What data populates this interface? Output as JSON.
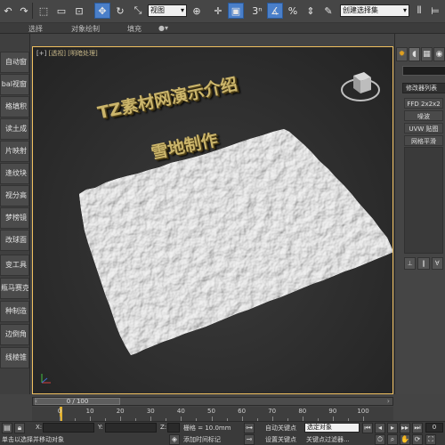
{
  "toolbar": {
    "selection_filter": "视图",
    "named_selection": "创建选择集",
    "snap_value": "3",
    "percent_snap": "%"
  },
  "ribbon": {
    "tabs": [
      "选择",
      "对象绘制",
      "填充"
    ]
  },
  "left_panel": {
    "items": [
      "自动窗",
      "bal视窗",
      "格填积",
      "读土成",
      "片映射",
      "逢纹块",
      "视分高",
      "梦榜镜",
      "改球面",
      "变工具",
      "瓶马赛克",
      "种制造",
      "边倒角",
      "线棱锥"
    ]
  },
  "viewport": {
    "label_prefix": "[+]",
    "label_view": "[透视]",
    "label_shading": "[明暗处理]",
    "caption_line1": "TZ素材网演示介绍",
    "caption_line2": "雪地制作",
    "surface_color": "#f2f2f2",
    "border_color": "#f0c060"
  },
  "command_panel": {
    "modifier_list": "修改器列表",
    "modifiers": [
      "FFD 2x2x2",
      "噪波",
      "UVW 贴图",
      "网格平滑"
    ]
  },
  "timeline": {
    "frame_label": "0 / 100",
    "ticks": [
      "0",
      "10",
      "20",
      "30",
      "40",
      "50",
      "60",
      "70",
      "80",
      "90",
      "100"
    ]
  },
  "status": {
    "x_label": "X:",
    "y_label": "Y:",
    "z_label": "Z:",
    "grid_label": "栅格 = 10.0mm",
    "auto_key": "自动关键点",
    "set_key": "设置关键点",
    "key_filters": "关键点过滤器...",
    "selection_set": "选定对象",
    "add_time_tag": "添加时间标记",
    "prompt": "单击以选择并移动对象",
    "frame_value": "0"
  }
}
